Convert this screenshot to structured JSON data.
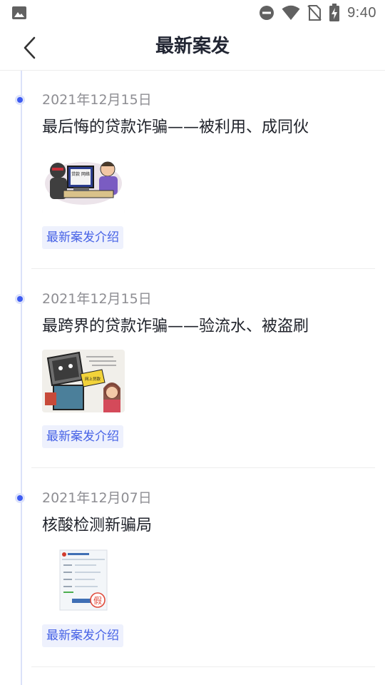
{
  "status_bar": {
    "time": "9:40",
    "icons": [
      "image-icon",
      "do-not-disturb-icon",
      "wifi-icon",
      "no-sim-icon",
      "battery-charging-icon"
    ]
  },
  "header": {
    "title": "最新案发",
    "back_icon": "chevron-left-icon"
  },
  "colors": {
    "accent": "#3d5bf2",
    "tag_text": "#4662e6",
    "tag_bg": "#eef1fd",
    "timeline": "#dbe2f9"
  },
  "cases": [
    {
      "date": "2021年12月15日",
      "title": "最后悔的贷款诈骗——被利用、成同伙",
      "tag": "最新案发介绍",
      "thumb_text": "贷款 网络",
      "thumb": "cartoon-scammer-computer"
    },
    {
      "date": "2021年12月15日",
      "title": "最跨界的贷款诈骗——验流水、被盗刷",
      "tag": "最新案发介绍",
      "thumb_text": "网上贷款",
      "thumb": "cartoon-monitor-woman"
    },
    {
      "date": "2021年12月07日",
      "title": "核酸检测新骗局",
      "tag": "最新案发介绍",
      "thumb_text": "假",
      "thumb": "fake-form-screenshot"
    }
  ]
}
